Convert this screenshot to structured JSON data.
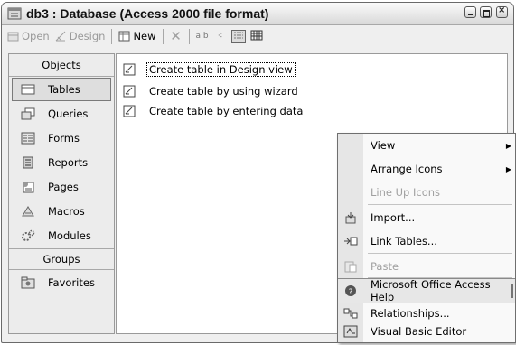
{
  "window": {
    "title": "db3 : Database (Access 2000 file format)"
  },
  "toolbar": {
    "open_label": "Open",
    "design_label": "Design",
    "new_label": "New",
    "view_small_label": "a b",
    "view_icons_label": "·∶"
  },
  "objects": {
    "header": "Objects",
    "items": [
      {
        "label": "Tables",
        "icon": "table-icon"
      },
      {
        "label": "Queries",
        "icon": "query-icon"
      },
      {
        "label": "Forms",
        "icon": "form-icon"
      },
      {
        "label": "Reports",
        "icon": "report-icon"
      },
      {
        "label": "Pages",
        "icon": "page-icon"
      },
      {
        "label": "Macros",
        "icon": "macro-icon"
      },
      {
        "label": "Modules",
        "icon": "module-icon"
      }
    ],
    "groups_header": "Groups",
    "groups": [
      {
        "label": "Favorites",
        "icon": "favorites-icon"
      }
    ],
    "selected": "Tables"
  },
  "content": {
    "items": [
      {
        "label": "Create table in Design view"
      },
      {
        "label": "Create table by using wizard"
      },
      {
        "label": "Create table by entering data"
      }
    ]
  },
  "context_menu": {
    "items": {
      "view": "View",
      "arrange": "Arrange Icons",
      "lineup": "Line Up Icons",
      "import": "Import...",
      "link": "Link Tables...",
      "paste": "Paste",
      "help": "Microsoft Office Access Help",
      "relationships": "Relationships...",
      "vbe": "Visual Basic Editor"
    },
    "highlighted": "Microsoft Office Access Help"
  },
  "colors": {
    "window_bg": "#efefef",
    "content_bg": "#ffffff",
    "menu_highlight": "#e7e7e7"
  }
}
